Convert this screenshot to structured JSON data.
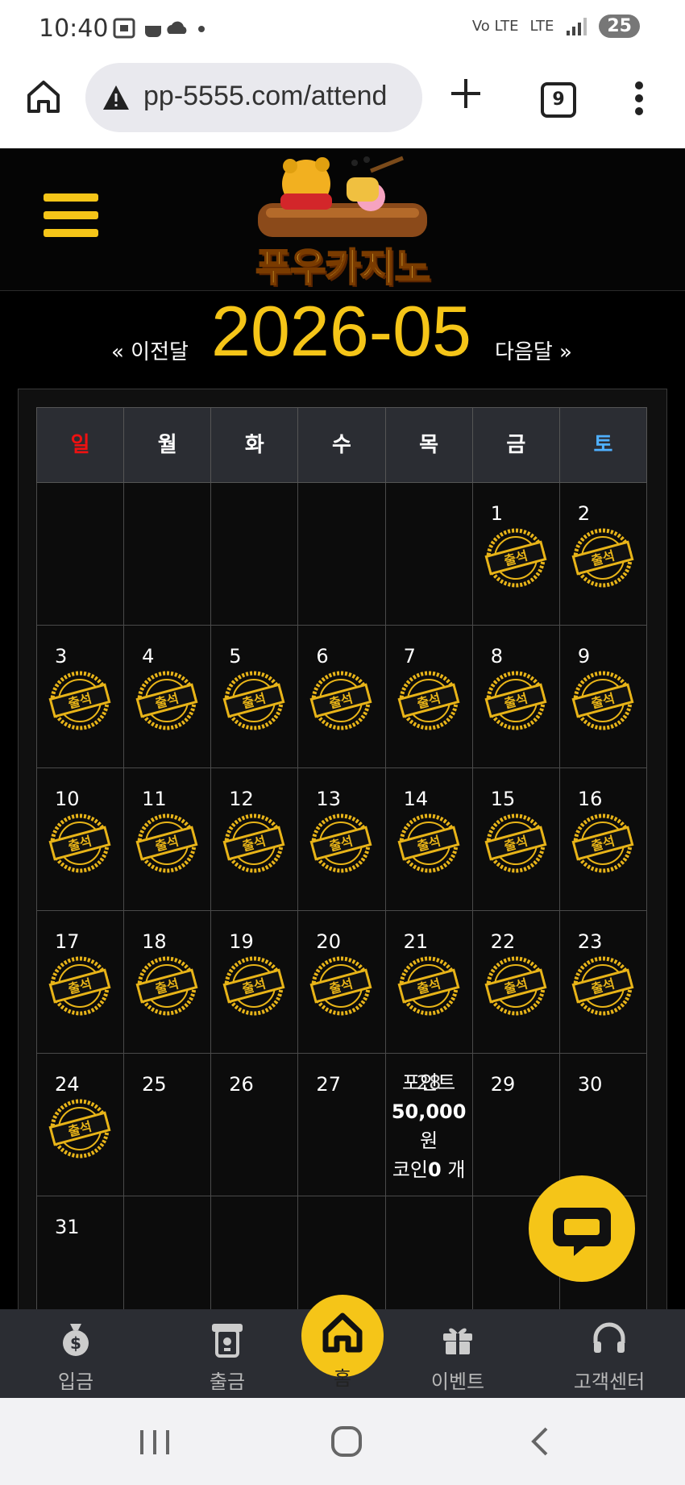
{
  "status_bar": {
    "time": "10:40",
    "network_a": "Vo LTE",
    "network_b": "LTE",
    "battery": "25"
  },
  "browser": {
    "url": "pp-5555.com/attend",
    "tab_count": "9"
  },
  "site": {
    "brand": "푸우카지노"
  },
  "calendar": {
    "prev_label": "« 이전달",
    "month": "2026-05",
    "next_label": "다음달 »",
    "weekdays": [
      "일",
      "월",
      "화",
      "수",
      "목",
      "금",
      "토"
    ],
    "stamp_text": "출석",
    "weeks": [
      [
        "",
        "",
        "",
        "",
        "",
        "1",
        "2"
      ],
      [
        "3",
        "4",
        "5",
        "6",
        "7",
        "8",
        "9"
      ],
      [
        "10",
        "11",
        "12",
        "13",
        "14",
        "15",
        "16"
      ],
      [
        "17",
        "18",
        "19",
        "20",
        "21",
        "22",
        "23"
      ],
      [
        "24",
        "25",
        "26",
        "27",
        "28",
        "29",
        "30"
      ],
      [
        "31",
        "",
        "",
        "",
        "",
        "",
        ""
      ]
    ],
    "attended_days": [
      1,
      2,
      3,
      4,
      5,
      6,
      7,
      8,
      9,
      10,
      11,
      12,
      13,
      14,
      15,
      16,
      17,
      18,
      19,
      20,
      21,
      22,
      23,
      24
    ],
    "today_summary": {
      "day": "28",
      "point_label": "포인트",
      "point_value": "50,000",
      "point_unit": "원",
      "coin_label": "코인",
      "coin_value": "0",
      "coin_unit": "개"
    }
  },
  "bottom_nav": {
    "deposit": "입금",
    "withdraw": "출금",
    "home": "홈",
    "event": "이벤트",
    "support": "고객센터"
  },
  "colors": {
    "accent": "#f5c518",
    "header_bg": "#2b2d33",
    "sunday": "#e11111",
    "saturday": "#4fb0ff"
  }
}
